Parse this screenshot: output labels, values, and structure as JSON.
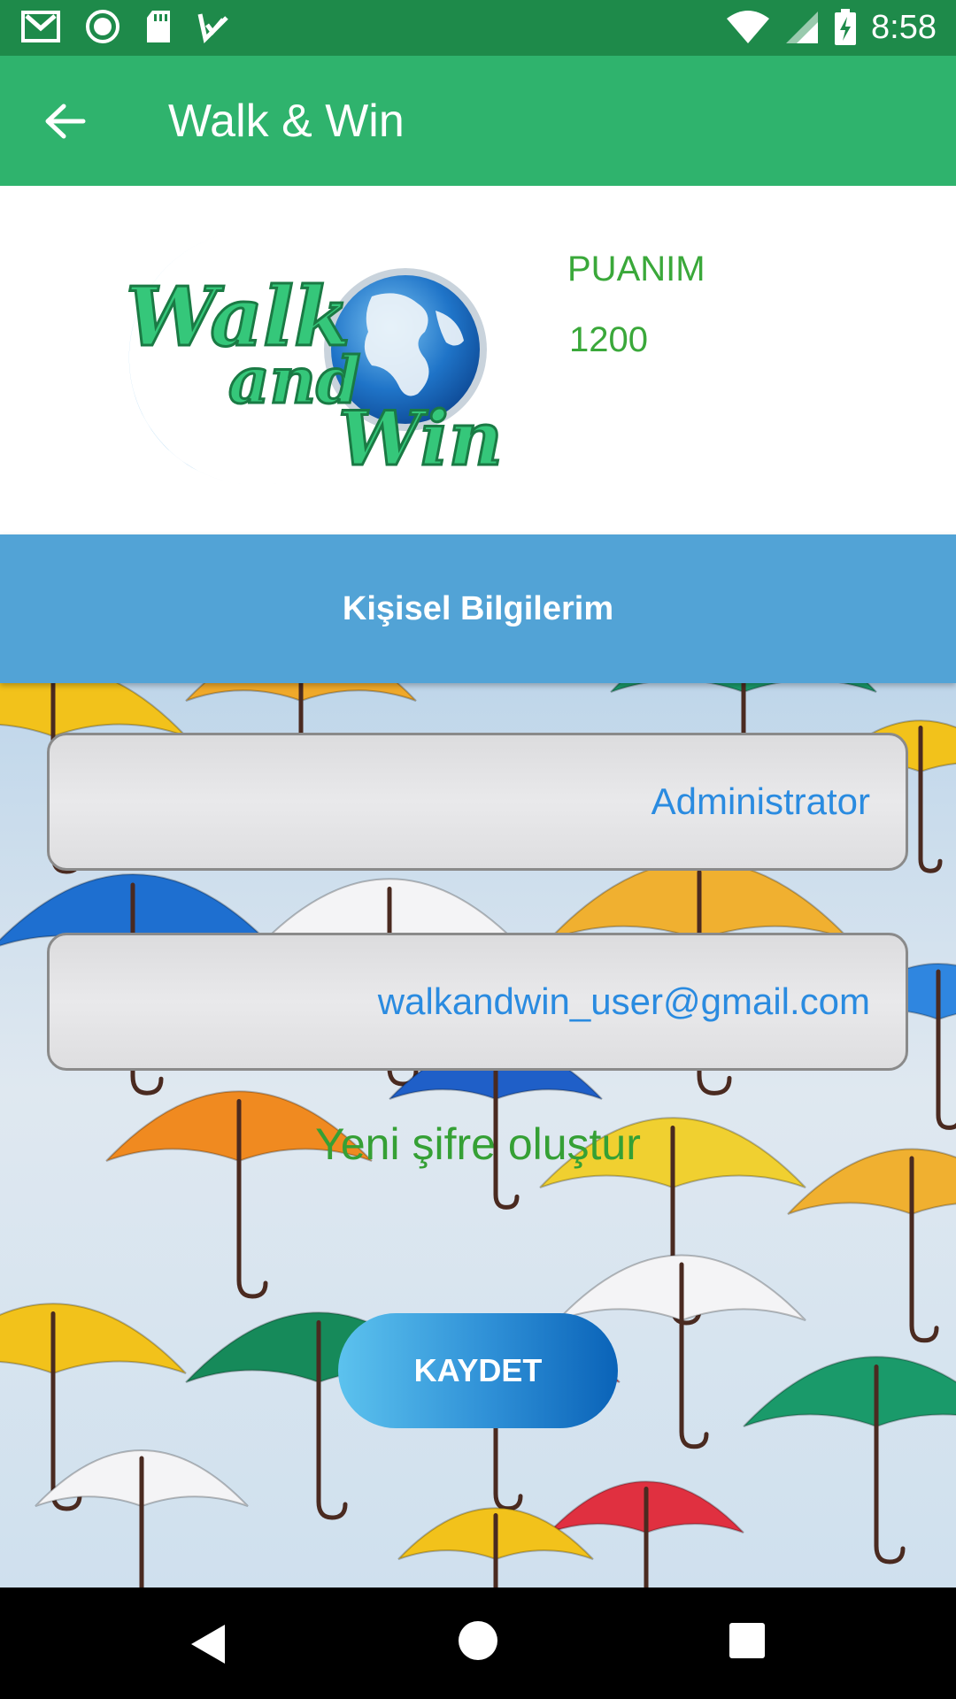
{
  "status_bar": {
    "time": "8:58",
    "left_icons": [
      "gmail-icon",
      "record-icon",
      "sd-card-icon",
      "task-check-icon"
    ],
    "right_icons": [
      "wifi-icon",
      "signal-icon",
      "battery-charging-icon"
    ]
  },
  "app_bar": {
    "title": "Walk & Win",
    "back_icon": "arrow-back-icon"
  },
  "profile": {
    "logo_text_line1": "Walk",
    "logo_text_line2": "and",
    "logo_text_line3": "Win",
    "points_label": "PUANIM",
    "points_value": "1200"
  },
  "section": {
    "title": "Kişisel Bilgilerim"
  },
  "form": {
    "name_value": "Administrator",
    "email_value": "walkandwin_user@gmail.com",
    "new_password_link": "Yeni şifre oluştur",
    "save_label": "KAYDET"
  },
  "colors": {
    "status_bar": "#1e8a4a",
    "app_bar": "#2fb36d",
    "section_header": "#52a3d6",
    "points_text": "#3aa83a",
    "field_text": "#2a8be0"
  },
  "nav_bar": {
    "icons": [
      "nav-back-icon",
      "nav-home-icon",
      "nav-recents-icon"
    ]
  }
}
